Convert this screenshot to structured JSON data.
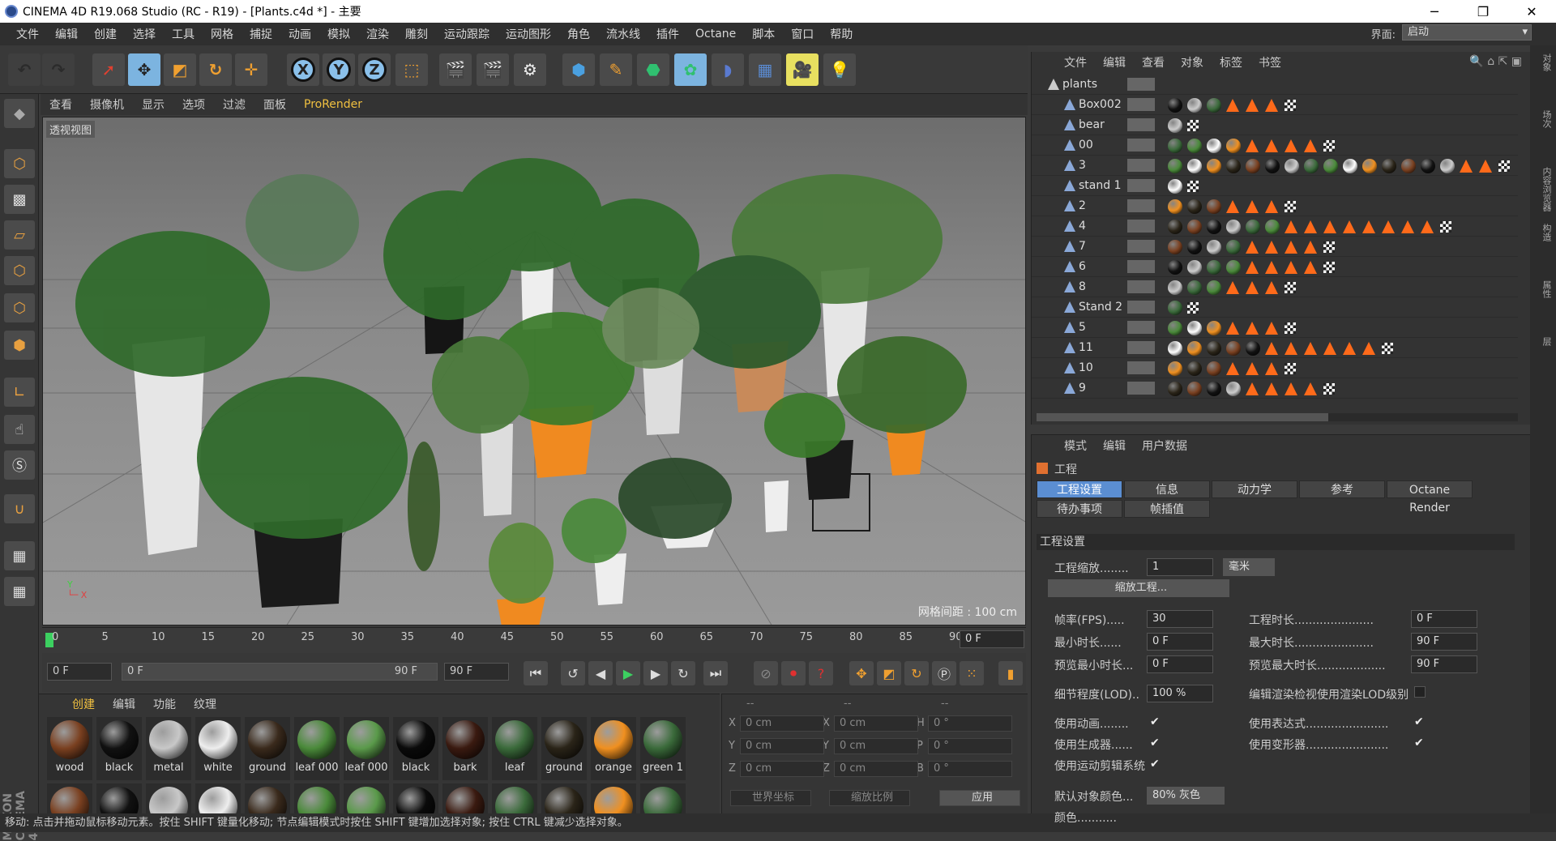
{
  "title": "CINEMA 4D R19.068 Studio (RC - R19) - [Plants.c4d *] - 主要",
  "menu": [
    "文件",
    "编辑",
    "创建",
    "选择",
    "工具",
    "网格",
    "捕捉",
    "动画",
    "模拟",
    "渲染",
    "雕刻",
    "运动跟踪",
    "运动图形",
    "角色",
    "流水线",
    "插件",
    "Octane",
    "脚本",
    "窗口",
    "帮助"
  ],
  "layout_label": "界面:",
  "layout_value": "启动",
  "viewport_menu": [
    "查看",
    "摄像机",
    "显示",
    "选项",
    "过滤",
    "面板",
    "ProRender"
  ],
  "viewport_label": "透视视图",
  "grid_info": "网格间距 : 100 cm",
  "timeline_ticks": [
    "0",
    "5",
    "10",
    "15",
    "20",
    "25",
    "30",
    "35",
    "40",
    "45",
    "50",
    "55",
    "60",
    "65",
    "70",
    "75",
    "80",
    "85",
    "90"
  ],
  "timeline_frame": "0 F",
  "transport": {
    "start": "0 F",
    "slider_left": "0 F",
    "slider_right": "90 F",
    "end": "90 F"
  },
  "material_tabs": [
    "创建",
    "编辑",
    "功能",
    "纹理"
  ],
  "materials": [
    {
      "name": "wood",
      "color": "#7a4020"
    },
    {
      "name": "black",
      "color": "#111111"
    },
    {
      "name": "metal",
      "color": "#c8c8c8"
    },
    {
      "name": "white",
      "color": "#eeeeee"
    },
    {
      "name": "ground",
      "color": "#3a2a1c"
    },
    {
      "name": "leaf 000",
      "color": "#4a8a3a"
    },
    {
      "name": "leaf 000",
      "color": "#5a9a4a"
    },
    {
      "name": "black",
      "color": "#0a0a0a"
    },
    {
      "name": "bark",
      "color": "#3a1a10"
    },
    {
      "name": "leaf",
      "color": "#3a6a3a"
    },
    {
      "name": "ground",
      "color": "#2a2418"
    },
    {
      "name": "orange",
      "color": "#f09020"
    },
    {
      "name": "green 1",
      "color": "#3a6a3a"
    }
  ],
  "coords": {
    "header": [
      "--",
      "--",
      "--"
    ],
    "rows": [
      {
        "a": "X",
        "v1": "0 cm",
        "b": "X",
        "v2": "0 cm",
        "c": "H",
        "v3": "0 °"
      },
      {
        "a": "Y",
        "v1": "0 cm",
        "b": "Y",
        "v2": "0 cm",
        "c": "P",
        "v3": "0 °"
      },
      {
        "a": "Z",
        "v1": "0 cm",
        "b": "Z",
        "v2": "0 cm",
        "c": "B",
        "v3": "0 °"
      }
    ],
    "world": "世界坐标",
    "scale": "缩放比例",
    "apply": "应用"
  },
  "objmgr_menu": [
    "文件",
    "编辑",
    "查看",
    "对象",
    "标签",
    "书签"
  ],
  "objects": [
    {
      "name": "plants",
      "tags": 0,
      "tri": 0
    },
    {
      "name": "Box002",
      "tags": 3,
      "tri": 3
    },
    {
      "name": "bear",
      "tags": 1,
      "tri": 0
    },
    {
      "name": "00",
      "tags": 4,
      "tri": 4
    },
    {
      "name": "3",
      "tags": 15,
      "tri": 2
    },
    {
      "name": "stand 1",
      "tags": 1,
      "tri": 0
    },
    {
      "name": "2",
      "tags": 3,
      "tri": 3
    },
    {
      "name": "4",
      "tags": 6,
      "tri": 8
    },
    {
      "name": "7",
      "tags": 4,
      "tri": 4
    },
    {
      "name": "6",
      "tags": 4,
      "tri": 4
    },
    {
      "name": "8",
      "tags": 3,
      "tri": 3
    },
    {
      "name": "Stand 2",
      "tags": 1,
      "tri": 0
    },
    {
      "name": "5",
      "tags": 3,
      "tri": 3
    },
    {
      "name": "11",
      "tags": 5,
      "tri": 6
    },
    {
      "name": "10",
      "tags": 3,
      "tri": 3
    },
    {
      "name": "9",
      "tags": 4,
      "tri": 4
    }
  ],
  "attr_menu": [
    "模式",
    "编辑",
    "用户数据"
  ],
  "attr_title": "工程",
  "attr_tabs": [
    "工程设置",
    "信息",
    "动力学",
    "参考",
    "Octane Render",
    "待办事项",
    "帧插值"
  ],
  "attr_section": "工程设置",
  "attr": {
    "scale_label": "工程缩放........",
    "scale_value": "1",
    "scale_unit": "毫米",
    "scale_btn": "缩放工程...",
    "fps_label": "帧率(FPS).....",
    "fps": "30",
    "duration_label": "工程时长......................",
    "duration": "0 F",
    "min_label": "最小时长......",
    "min": "0 F",
    "max_label": "最大时长......................",
    "max": "90 F",
    "pmin_label": "预览最小时长...",
    "pmin": "0 F",
    "pmax_label": "预览最大时长...................",
    "pmax": "90 F",
    "lod_label": "细节程度(LOD)..",
    "lod": "100 %",
    "lod2_label": "编辑渲染检视使用渲染LOD级别",
    "anim_label": "使用动画........",
    "expr_label": "使用表达式.......................",
    "gen_label": "使用生成器......",
    "def_label": "使用变形器.......................",
    "motion_label": "使用运动剪辑系统",
    "color_label": "默认对象颜色...",
    "color_value": "80% 灰色",
    "col_label": "颜色..........."
  },
  "status": "移动: 点击并拖动鼠标移动元素。按住 SHIFT 键量化移动; 节点编辑模式时按住 SHIFT 键增加选择对象; 按住 CTRL 键减少选择对象。",
  "right_strip": [
    "对象",
    "场次",
    "内容浏览器",
    "构造",
    "属性",
    "层"
  ]
}
